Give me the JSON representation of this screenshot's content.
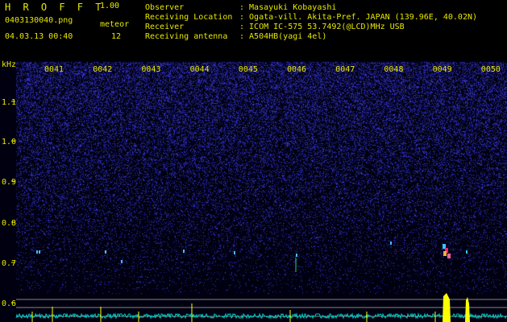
{
  "app": {
    "title": "H R O F F T",
    "version": "1.00"
  },
  "file": {
    "name": "0403130040.png",
    "datetime": "04.03.13 00:40"
  },
  "meteor": {
    "label": "meteor",
    "count": "12"
  },
  "info": [
    {
      "label": "Observer",
      "value": ": Masayuki Kobayashi"
    },
    {
      "label": "Receiving Location",
      "value": ": Ogata-vill. Akita-Pref. JAPAN (139.96E, 40.02N)"
    },
    {
      "label": "Receiver",
      "value": ": ICOM IC-575 53.7492(@LCD)MHz USB"
    },
    {
      "label": "Receiving antenna",
      "value": ": A504HB(yagi 4el)"
    }
  ],
  "chart_data": {
    "type": "heatmap",
    "y_unit_label": "kHz",
    "y_ticks": [
      "1.1",
      "1.0",
      "0.9",
      "0.8",
      "0.7",
      "0.6"
    ],
    "x_ticks": [
      "0041",
      "0042",
      "0043",
      "0044",
      "0045",
      "0046",
      "0047",
      "0048",
      "0049",
      "0050"
    ],
    "colors": {
      "text": "#e8e800",
      "background": "#000010",
      "noise": "#1a1aa8",
      "signal_baseline": "#00c8c8",
      "meteor_strong": "#ff2060",
      "meteor_power": "#ffff00"
    }
  }
}
